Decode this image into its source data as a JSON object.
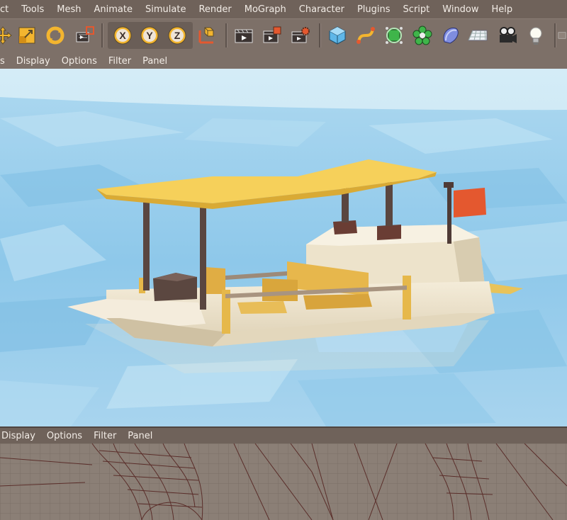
{
  "menubar": {
    "items": [
      "ct",
      "Tools",
      "Mesh",
      "Animate",
      "Simulate",
      "Render",
      "MoGraph",
      "Character",
      "Plugins",
      "Script",
      "Window",
      "Help"
    ]
  },
  "toolbar": {
    "icons": [
      "move-icon",
      "scale-icon",
      "rotate-icon",
      "render-region-icon",
      "x-axis-lock-icon",
      "y-axis-lock-icon",
      "z-axis-lock-icon",
      "coordinate-system-icon",
      "render-view-icon",
      "render-picture-viewer-icon",
      "render-settings-icon",
      "cube-icon",
      "spline-pen-icon",
      "nurbs-icon",
      "array-icon",
      "deformer-icon",
      "floor-icon",
      "camera-icon",
      "light-icon"
    ],
    "axis_labels": {
      "x": "X",
      "y": "Y",
      "z": "Z"
    }
  },
  "viewport_top": {
    "menu": [
      "s",
      "Display",
      "Options",
      "Filter",
      "Panel"
    ]
  },
  "viewport_bottom": {
    "menu": [
      "Display",
      "Options",
      "Filter",
      "Panel"
    ]
  },
  "colors": {
    "menubar": "#6f625a",
    "toolbar": "#7d7068",
    "water": "#9fd0ec",
    "canopy": "#f2c94c",
    "hull": "#ece3cf",
    "flag": "#e4582f"
  }
}
